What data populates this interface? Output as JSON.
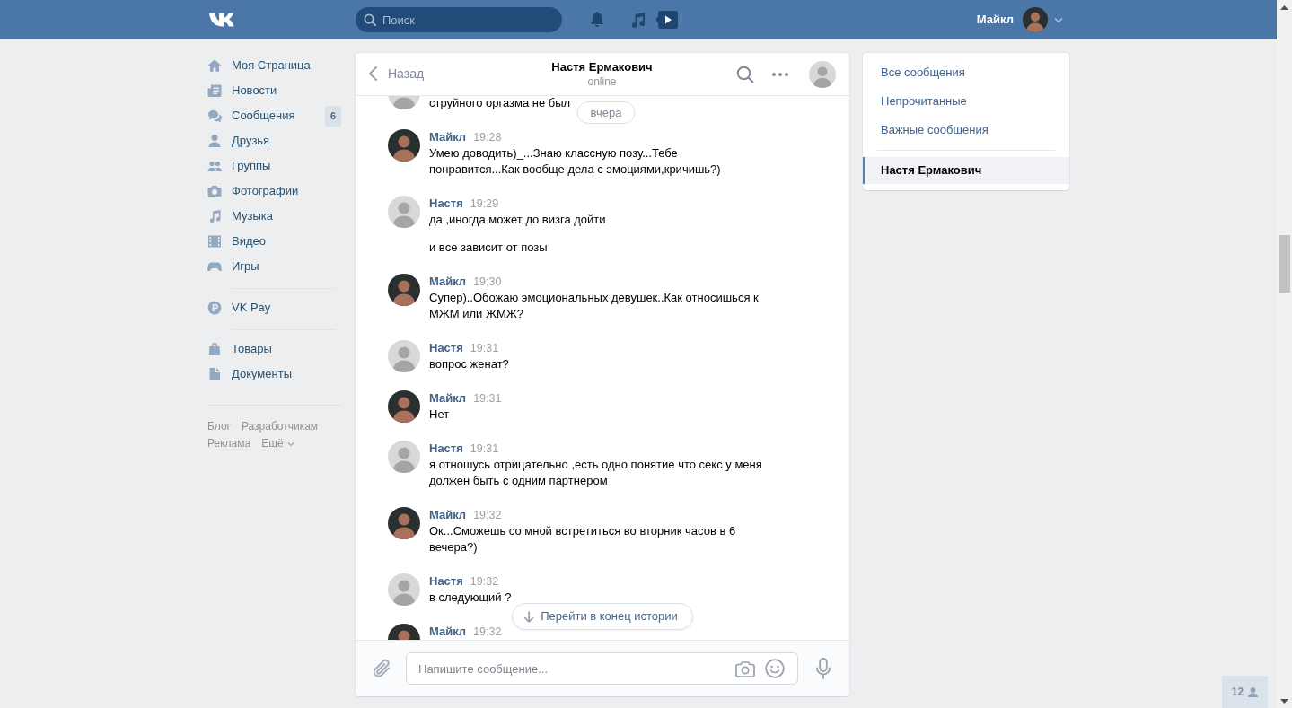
{
  "header": {
    "search": {
      "placeholder": "Поиск"
    },
    "user": {
      "name": "Майкл"
    }
  },
  "sidebar": {
    "sections": [
      {
        "items": [
          {
            "label": "Моя Страница"
          },
          {
            "label": "Новости"
          },
          {
            "label": "Сообщения",
            "badge": "6"
          },
          {
            "label": "Друзья"
          },
          {
            "label": "Группы"
          },
          {
            "label": "Фотографии"
          },
          {
            "label": "Музыка"
          },
          {
            "label": "Видео"
          },
          {
            "label": "Игры"
          }
        ]
      },
      {
        "items": [
          {
            "label": "VK Pay"
          }
        ]
      },
      {
        "items": [
          {
            "label": "Товары"
          },
          {
            "label": "Документы"
          }
        ]
      }
    ],
    "footer": {
      "links": [
        "Блог",
        "Разработчикам",
        "Реклама"
      ],
      "more": "Ещё"
    }
  },
  "chat": {
    "back": "Назад",
    "title": "Настя Ермакович",
    "status": "online",
    "date_divider": "вчера",
    "messages": [
      {
        "kind": "peer",
        "texts": [
          "струйного оргазма не был"
        ]
      },
      {
        "kind": "self",
        "author": "Майкл",
        "time": "19:28",
        "texts": [
          "Умею доводить)_...Знаю классную позу...Тебе понравится...Как вообще дела с эмоциями,кричишь?)"
        ]
      },
      {
        "kind": "peer",
        "author": "Настя",
        "time": "19:29",
        "texts": [
          "да ,иногда может до визга дойти",
          "и все зависит от позы"
        ]
      },
      {
        "kind": "self",
        "author": "Майкл",
        "time": "19:30",
        "texts": [
          "Супер)..Обожаю эмоциональных девушек..Как относишься к МЖМ или ЖМЖ?"
        ]
      },
      {
        "kind": "peer",
        "author": "Настя",
        "time": "19:31",
        "texts": [
          "вопрос женат?"
        ]
      },
      {
        "kind": "self",
        "author": "Майкл",
        "time": "19:31",
        "texts": [
          "Нет"
        ]
      },
      {
        "kind": "peer",
        "author": "Настя",
        "time": "19:31",
        "texts": [
          "я отношусь отрицательно ,есть одно понятие что секс у меня должен быть с одним партнером"
        ]
      },
      {
        "kind": "self",
        "author": "Майкл",
        "time": "19:32",
        "texts": [
          "Ок...Сможешь со мной встретиться во вторник часов в 6 вечера?)"
        ]
      },
      {
        "kind": "peer",
        "author": "Настя",
        "time": "19:32",
        "texts": [
          "в следующий ?"
        ]
      },
      {
        "kind": "self",
        "author": "Майкл",
        "time": "19:32"
      }
    ],
    "jump_button": "Перейти в конец истории",
    "composer": {
      "placeholder": "Напишите сообщение..."
    }
  },
  "filters": {
    "items": [
      {
        "label": "Все сообщения",
        "selected": false
      },
      {
        "label": "Непрочитанные",
        "selected": false
      },
      {
        "label": "Важные сообщения",
        "selected": false
      }
    ],
    "conversations": [
      {
        "label": "Настя Ермакович",
        "selected": true
      }
    ]
  },
  "online_widget": {
    "count": "12"
  }
}
